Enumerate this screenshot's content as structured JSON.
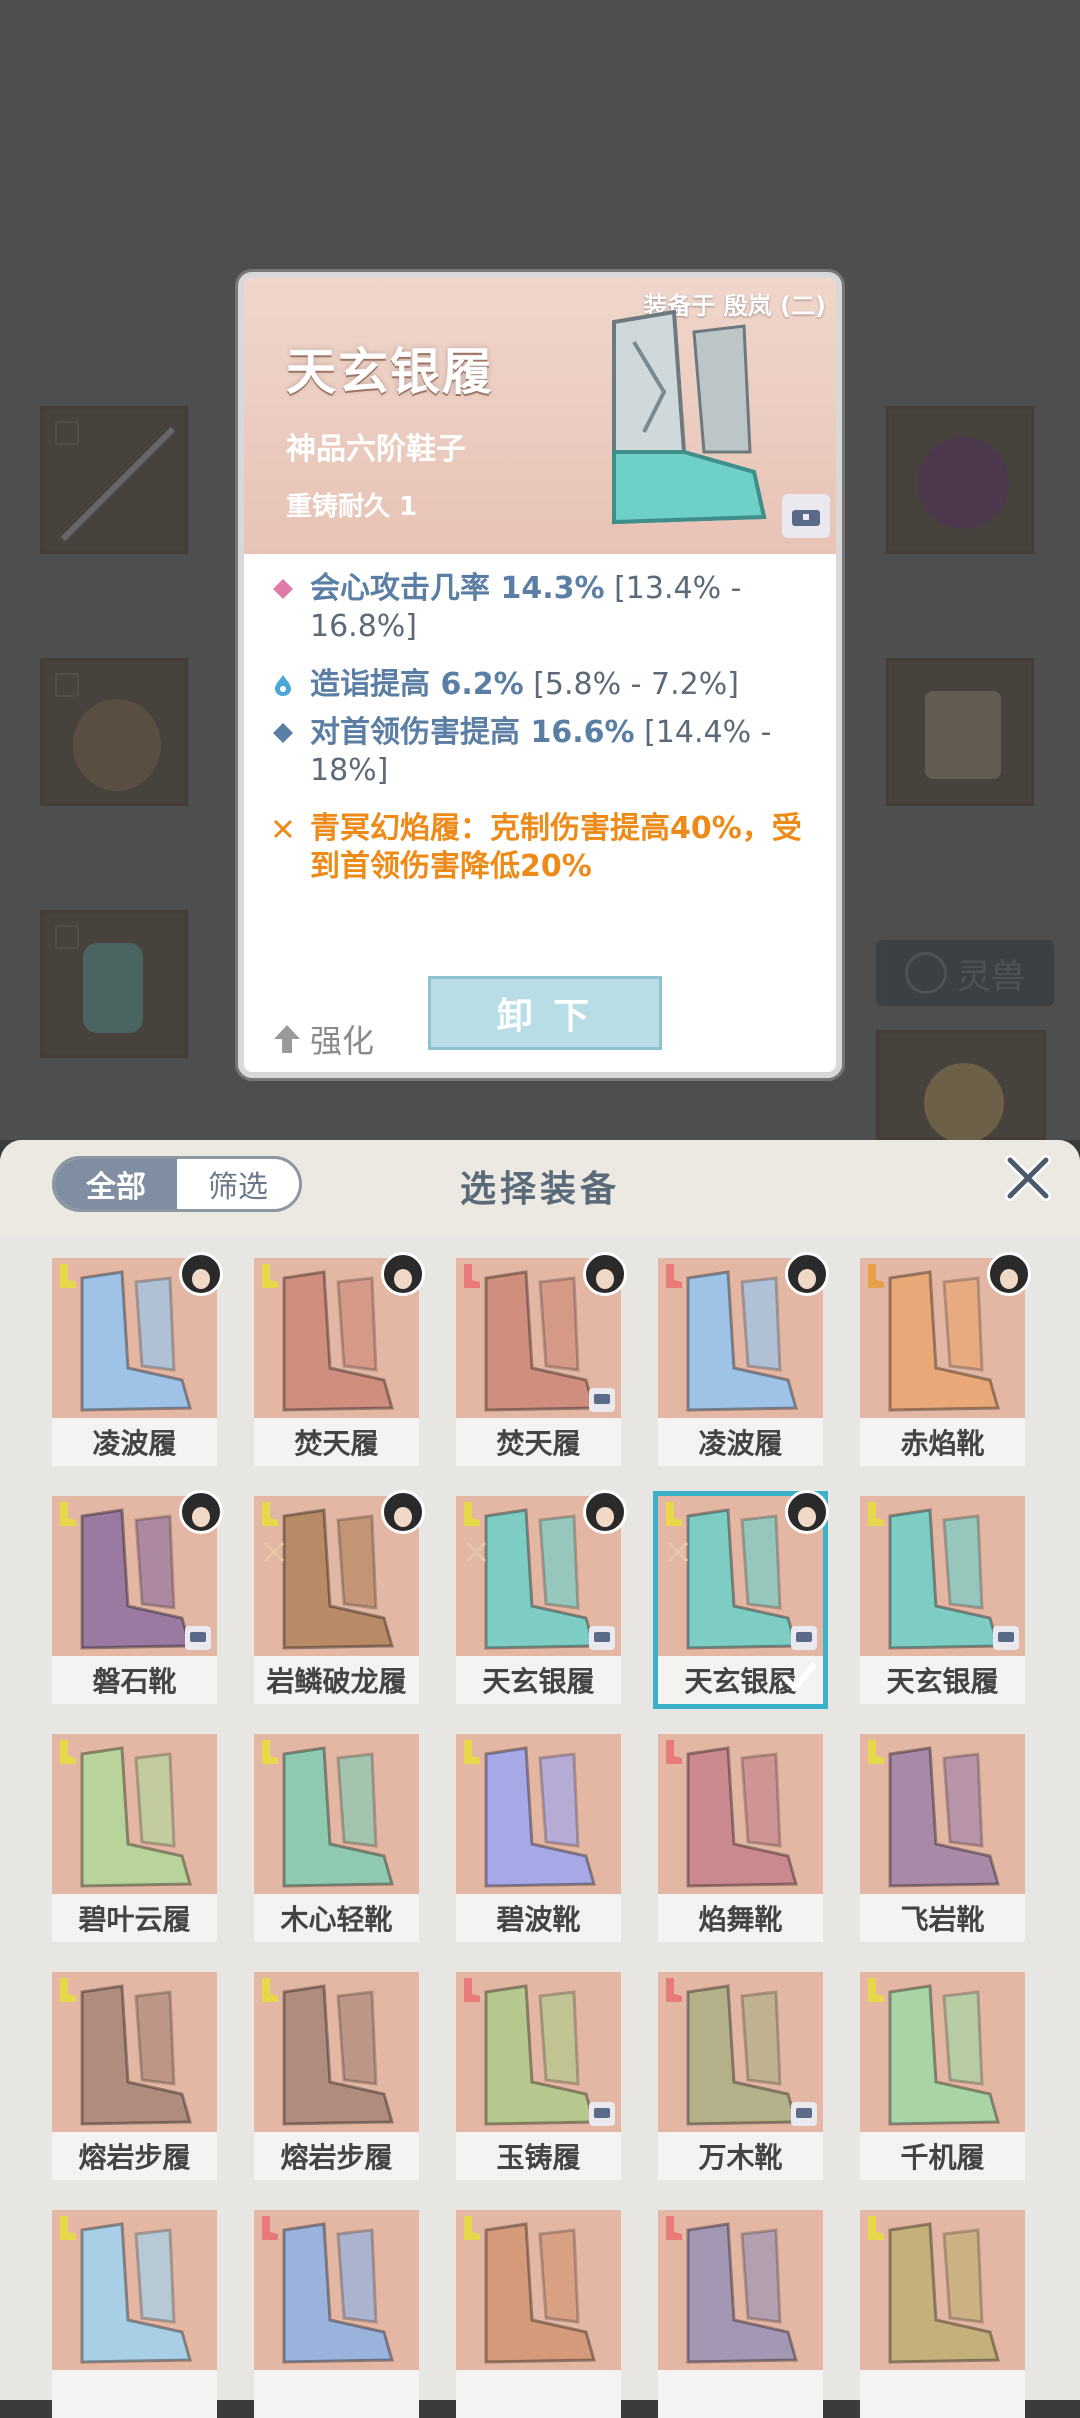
{
  "popup": {
    "equipped_on": "装备于 殷岚 (二)",
    "title": "天玄银履",
    "type": "神品六阶鞋子",
    "durability": "重铸耐久 1",
    "stats": [
      {
        "name": "会心攻击几率 14.3%",
        "range": " [13.4% - 16.8%]",
        "icon": "diamond-pink-icon"
      },
      {
        "name": "造诣提高 6.2%",
        "range": " [5.8% - 7.2%]",
        "icon": "flame-blue-icon"
      },
      {
        "name": "对首领伤害提高 16.6%",
        "range": " [14.4% - 18%]",
        "icon": "diamond-blue-icon"
      }
    ],
    "special": "青冥幻焰履：克制伤害提高40%，受到首领伤害降低20%",
    "strengthen_label": "强化",
    "unequip_label": "卸 下"
  },
  "background": {
    "beast_tab_label": "灵兽"
  },
  "sheet": {
    "filter_all": "全部",
    "filter_select": "筛选",
    "title": "选择装备",
    "items": [
      {
        "name": "凌波履",
        "color": "#9fc3e6",
        "badge": "#e7d84a",
        "avatar": true,
        "chest": false,
        "selected": false,
        "mark": false
      },
      {
        "name": "焚天履",
        "color": "#d08f7e",
        "badge": "#e7d84a",
        "avatar": true,
        "chest": false,
        "selected": false,
        "mark": false
      },
      {
        "name": "焚天履",
        "color": "#d08f7e",
        "badge": "#e87a7a",
        "avatar": true,
        "chest": true,
        "selected": false,
        "mark": false
      },
      {
        "name": "凌波履",
        "color": "#9fc3e6",
        "badge": "#e87a7a",
        "avatar": true,
        "chest": false,
        "selected": false,
        "mark": false
      },
      {
        "name": "赤焰靴",
        "color": "#e9a877",
        "badge": "#e7a04a",
        "avatar": true,
        "chest": false,
        "selected": false,
        "mark": false
      },
      {
        "name": "磐石靴",
        "color": "#9a7aa0",
        "badge": "#e7d84a",
        "avatar": true,
        "chest": true,
        "selected": false,
        "mark": false
      },
      {
        "name": "岩鳞破龙履",
        "color": "#b88a66",
        "badge": "#e7d84a",
        "avatar": true,
        "chest": false,
        "selected": false,
        "mark": true
      },
      {
        "name": "天玄银履",
        "color": "#7ecdc4",
        "badge": "#e7d84a",
        "avatar": true,
        "chest": true,
        "selected": false,
        "mark": true
      },
      {
        "name": "天玄银履",
        "color": "#7ecdc4",
        "badge": "#e7d84a",
        "avatar": true,
        "chest": true,
        "selected": true,
        "mark": true
      },
      {
        "name": "天玄银履",
        "color": "#7ecdc4",
        "badge": "#e7d84a",
        "avatar": false,
        "chest": true,
        "selected": false,
        "mark": false
      },
      {
        "name": "碧叶云履",
        "color": "#b8d49a",
        "badge": "#e7d84a",
        "avatar": false,
        "chest": false,
        "selected": false,
        "mark": false
      },
      {
        "name": "木心轻靴",
        "color": "#8fc9b0",
        "badge": "#e7d84a",
        "avatar": false,
        "chest": false,
        "selected": false,
        "mark": false
      },
      {
        "name": "碧波靴",
        "color": "#a7a8e6",
        "badge": "#e7d84a",
        "avatar": false,
        "chest": false,
        "selected": false,
        "mark": false
      },
      {
        "name": "焰舞靴",
        "color": "#c9898f",
        "badge": "#e87a7a",
        "avatar": false,
        "chest": false,
        "selected": false,
        "mark": false
      },
      {
        "name": "飞岩靴",
        "color": "#a889a8",
        "badge": "#e7d84a",
        "avatar": false,
        "chest": false,
        "selected": false,
        "mark": false
      },
      {
        "name": "熔岩步履",
        "color": "#b08c7e",
        "badge": "#e7d84a",
        "avatar": false,
        "chest": false,
        "selected": false,
        "mark": false
      },
      {
        "name": "熔岩步履",
        "color": "#b08c7e",
        "badge": "#e7d84a",
        "avatar": false,
        "chest": false,
        "selected": false,
        "mark": false
      },
      {
        "name": "玉铸履",
        "color": "#b7c88e",
        "badge": "#e87a7a",
        "avatar": false,
        "chest": true,
        "selected": false,
        "mark": false
      },
      {
        "name": "万木靴",
        "color": "#b4b08a",
        "badge": "#e87a7a",
        "avatar": false,
        "chest": true,
        "selected": false,
        "mark": false
      },
      {
        "name": "千机履",
        "color": "#a9d4a6",
        "badge": "#e7d84a",
        "avatar": false,
        "chest": false,
        "selected": false,
        "mark": false
      },
      {
        "name": "",
        "color": "#a8cfe6",
        "badge": "#e7d84a",
        "avatar": false,
        "chest": false,
        "selected": false,
        "mark": false
      },
      {
        "name": "",
        "color": "#9ab2dc",
        "badge": "#e87a7a",
        "avatar": false,
        "chest": false,
        "selected": false,
        "mark": false
      },
      {
        "name": "",
        "color": "#d49a7a",
        "badge": "#e7d84a",
        "avatar": false,
        "chest": false,
        "selected": false,
        "mark": false
      },
      {
        "name": "",
        "color": "#a497b4",
        "badge": "#e87a7a",
        "avatar": false,
        "chest": false,
        "selected": false,
        "mark": false
      },
      {
        "name": "",
        "color": "#c4b07a",
        "badge": "#e7d84a",
        "avatar": false,
        "chest": false,
        "selected": false,
        "mark": false
      }
    ]
  },
  "colors": {
    "accent_blue": "#5b7ea5",
    "special_orange": "#ee8a18",
    "selected_outline": "#3bb1c8"
  }
}
